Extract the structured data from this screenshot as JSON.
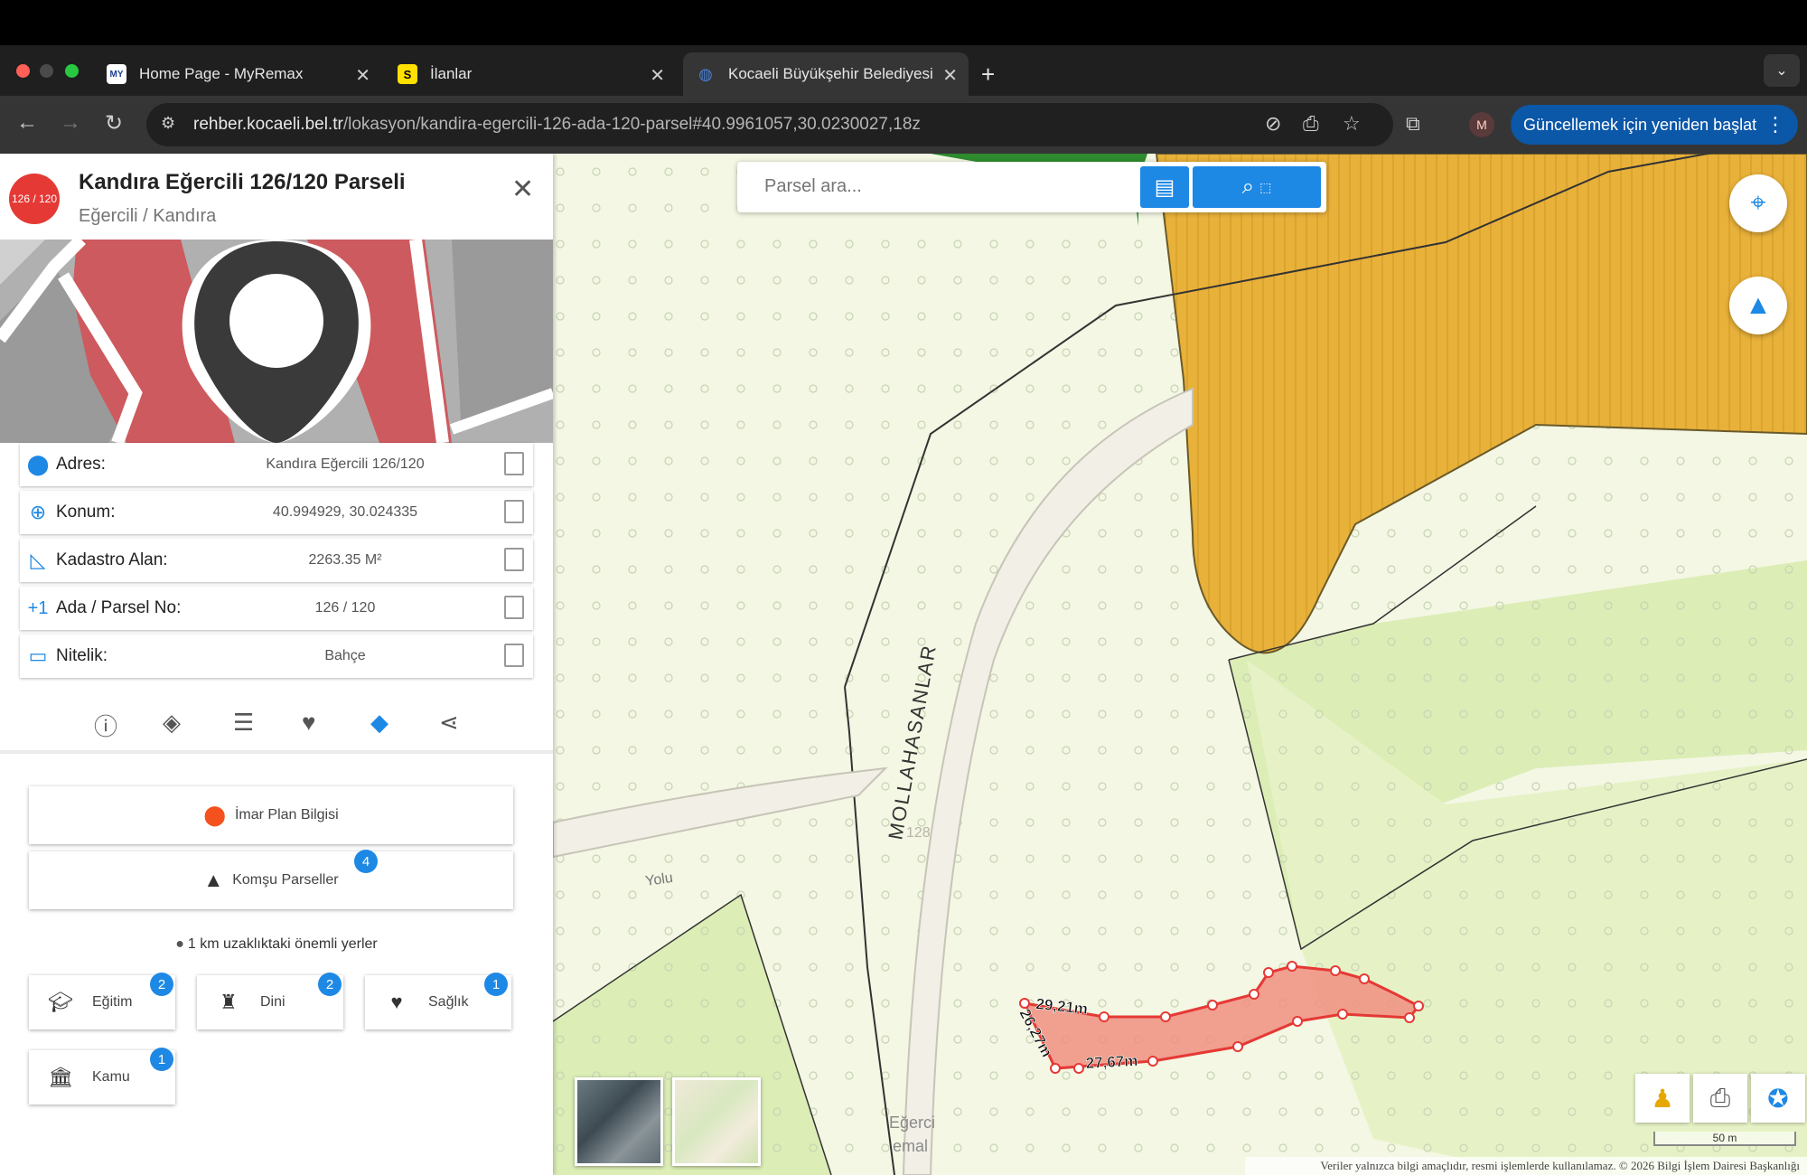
{
  "browser": {
    "tabs": [
      {
        "title": "Home Page - MyRemax",
        "favicon": "MY"
      },
      {
        "title": "İlanlar",
        "favicon": "S"
      },
      {
        "title": "Kocaeli Büyükşehir Belediyesi",
        "favicon": "globe"
      }
    ],
    "url_host": "rehber.kocaeli.bel.tr",
    "url_path": "/lokasyon/kandira-egercili-126-ada-120-parsel#40.9961057,30.0230027,18z",
    "profile_initial": "M",
    "update_label": "Güncellemek için yeniden başlat"
  },
  "panel": {
    "badge": "126 / 120",
    "title": "Kandıra Eğercili 126/120 Parseli",
    "subtitle": "Eğercili / Kandıra",
    "rows": [
      {
        "icon": "location-pin-icon",
        "label": "Adres:",
        "value": "Kandıra Eğercili 126/120"
      },
      {
        "icon": "crosshair-icon",
        "label": "Konum:",
        "value": "40.994929, 30.024335"
      },
      {
        "icon": "area-icon",
        "label": "Kadastro Alan:",
        "value": "2263.35 M²"
      },
      {
        "icon": "plus-one-icon",
        "label": "Ada / Parsel No:",
        "value": "126 / 120"
      },
      {
        "icon": "tag-icon",
        "label": "Nitelik:",
        "value": "Bahçe"
      }
    ],
    "imar_label": "İmar Plan Bilgisi",
    "komsu_label": "Komşu Parseller",
    "komsu_count": "4",
    "nearby_title": "1 km uzaklıktaki önemli yerler",
    "categories": [
      {
        "label": "Eğitim",
        "count": "2"
      },
      {
        "label": "Dini",
        "count": "2"
      },
      {
        "label": "Sağlık",
        "count": "1"
      },
      {
        "label": "Kamu",
        "count": "1"
      }
    ]
  },
  "map": {
    "search_placeholder": "Parsel ara...",
    "road_label": "MOLLAHASANLAR",
    "road_label2": "Yolu",
    "parcel_number": "128",
    "dimensions": [
      "29,21m",
      "26,27m",
      "27,67m"
    ],
    "place_partial": "Eğerci",
    "place_partial2": "emal",
    "scale": "50 m",
    "disclaimer": "Veriler yalnızca bilgi amaçlıdır, resmi işlemlerde kullanılamaz. © 2026 Bilgi İşlem Dairesi Başkanlığı",
    "colors": {
      "base": "#f3f7e3",
      "green": "#dcedb6",
      "yellow": "#e8b13a",
      "parcel": "#f08f80"
    }
  }
}
